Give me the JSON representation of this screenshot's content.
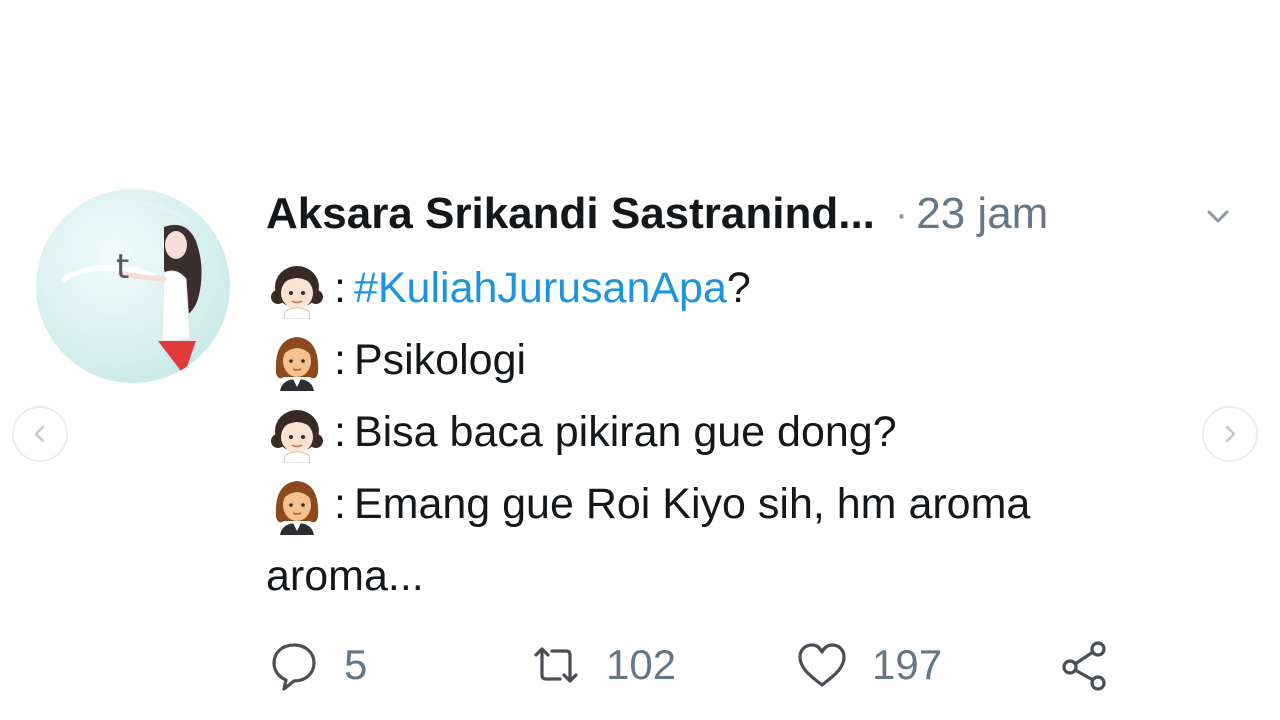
{
  "tweet": {
    "author": {
      "display_name": "Aksara Srikandi Sastranind...",
      "avatar_letter": "t",
      "avatar_icon": "illustrated-girl-avatar"
    },
    "separator": "·",
    "timestamp": "23 jam",
    "menu_icon": "chevron-down-icon",
    "body": {
      "lines": [
        {
          "speaker_icon": "girl-emoji-icon",
          "colon": ":",
          "prefix": "",
          "hashtag": "#KuliahJurusanApa",
          "suffix": "?"
        },
        {
          "speaker_icon": "woman-emoji-icon",
          "colon": ":",
          "text": "Psikologi"
        },
        {
          "speaker_icon": "girl-emoji-icon",
          "colon": ":",
          "text": "Bisa baca pikiran gue dong?"
        },
        {
          "speaker_icon": "woman-emoji-icon",
          "colon": ":",
          "text": "Emang gue Roi Kiyo sih, hm aroma"
        }
      ],
      "wrap": "aroma..."
    },
    "actions": {
      "reply": {
        "icon": "reply-icon",
        "count": "5"
      },
      "retweet": {
        "icon": "retweet-icon",
        "count": "102"
      },
      "like": {
        "icon": "heart-icon",
        "count": "197"
      },
      "share": {
        "icon": "share-icon"
      }
    }
  },
  "carousel": {
    "prev_icon": "chevron-left-icon",
    "next_icon": "chevron-right-icon"
  },
  "colors": {
    "hashtag": "#1b95e0",
    "muted": "#657786",
    "text": "#14171a"
  }
}
